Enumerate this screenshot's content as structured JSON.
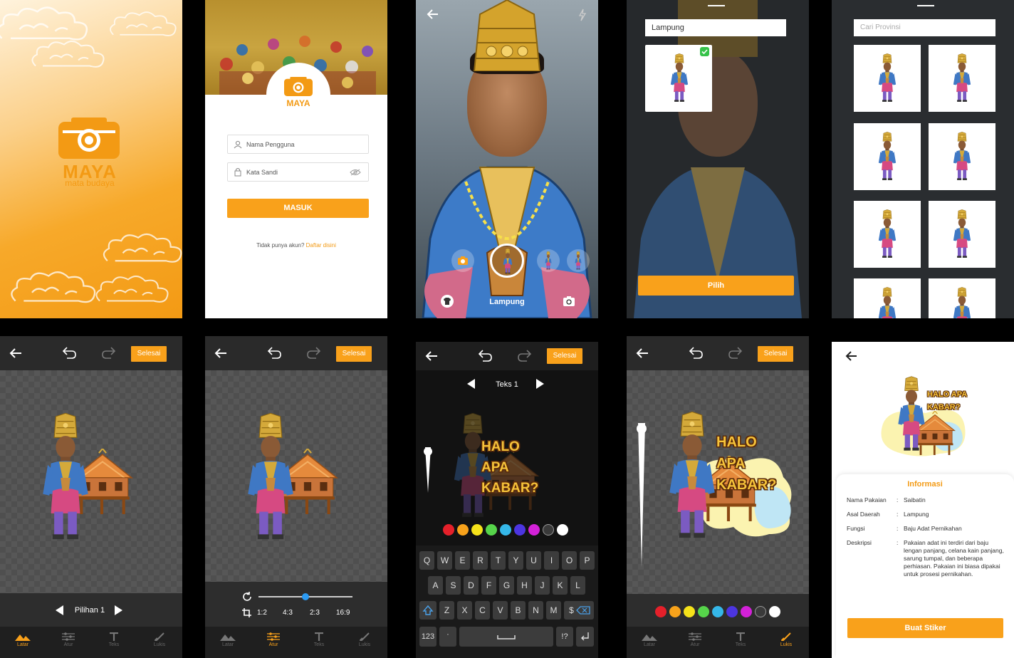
{
  "splash": {
    "logo_title": "MAYA",
    "logo_subtitle": "mata budaya"
  },
  "login": {
    "logo_title": "MAYA",
    "username_placeholder": "Nama Pengguna",
    "password_placeholder": "Kata Sandi",
    "login_button": "MASUK",
    "no_account_text": "Tidak punya akun?",
    "register_link": "Daftar disini"
  },
  "camera": {
    "province_label": "Lampung"
  },
  "picker": {
    "search_value": "Lampung",
    "choose_button": "Pilih"
  },
  "grid": {
    "search_placeholder": "Cari Provinsi"
  },
  "editor_common": {
    "done_label": "Selesai",
    "nav": [
      "Latar",
      "Atur",
      "Teks",
      "Lukis"
    ]
  },
  "editor_latar": {
    "option_label": "Pilihan 1"
  },
  "editor_atur": {
    "ratios": [
      "1:2",
      "4:3",
      "2:3",
      "16:9"
    ],
    "slider_value": 0.5
  },
  "editor_teks": {
    "text_label": "Teks 1",
    "sticker_text_line1": "HALO APA",
    "sticker_text_line2": "KABAR?",
    "colors": [
      "#e5202a",
      "#f7a21b",
      "#f5e21a",
      "#56d44a",
      "#35b7e8",
      "#4c35e0",
      "#d321d8",
      "#3a3a3a",
      "#ffffff"
    ],
    "keyboard_row1": [
      "Q",
      "W",
      "E",
      "R",
      "T",
      "Y",
      "U",
      "I",
      "O",
      "P"
    ],
    "keyboard_row2": [
      "A",
      "S",
      "D",
      "F",
      "G",
      "H",
      "J",
      "K",
      "L"
    ],
    "keyboard_row3": [
      "Z",
      "X",
      "C",
      "V",
      "B",
      "N",
      "M",
      "$"
    ],
    "key_123": "123",
    "key_punct": "!?"
  },
  "editor_lukis": {
    "sticker_text_line1": "HALO APA",
    "sticker_text_line2": "KABAR?",
    "colors": [
      "#e5202a",
      "#f7a21b",
      "#f5e21a",
      "#56d44a",
      "#35b7e8",
      "#4c35e0",
      "#d321d8",
      "#3a3a3a",
      "#ffffff"
    ]
  },
  "info": {
    "sticker_text_line1": "HALO APA",
    "sticker_text_line2": "KABAR?",
    "section_title": "Informasi",
    "rows": [
      {
        "label": "Nama Pakaian",
        "value": "Saibatin"
      },
      {
        "label": "Asal Daerah",
        "value": "Lampung"
      },
      {
        "label": "Fungsi",
        "value": "Baju Adat Pernikahan"
      },
      {
        "label": "Deskripsi",
        "value": "Pakaian adat ini terdiri dari baju lengan panjang, celana kain panjang, sarung tumpal, dan beberapa perhiasan. Pakaian ini biasa dipakai untuk prosesi pernikahan."
      }
    ],
    "create_button": "Buat Stiker"
  },
  "colors": {
    "accent": "#f9a11b",
    "editor_bg": "#2a2a2a"
  }
}
